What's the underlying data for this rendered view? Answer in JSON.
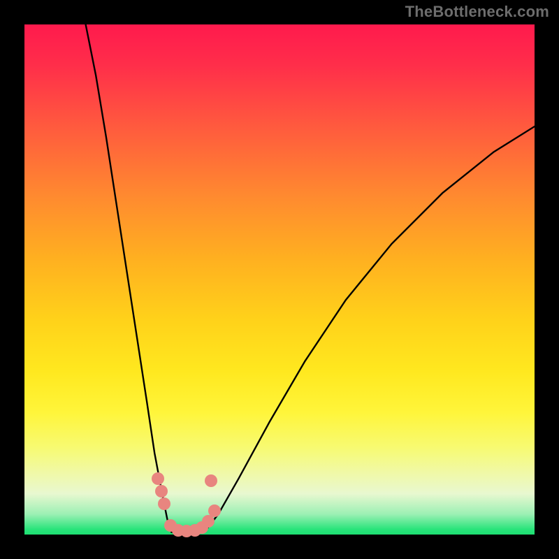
{
  "attribution": "TheBottleneck.com",
  "chart_data": {
    "type": "line",
    "title": "",
    "xlabel": "",
    "ylabel": "",
    "xlim": [
      0,
      100
    ],
    "ylim": [
      0,
      100
    ],
    "gradient_stops": [
      {
        "pct": 0,
        "color": "#ff1a4d"
      },
      {
        "pct": 8,
        "color": "#ff2e4a"
      },
      {
        "pct": 20,
        "color": "#ff5a3e"
      },
      {
        "pct": 34,
        "color": "#ff8b2f"
      },
      {
        "pct": 46,
        "color": "#ffb020"
      },
      {
        "pct": 58,
        "color": "#ffd21a"
      },
      {
        "pct": 68,
        "color": "#ffe81f"
      },
      {
        "pct": 76,
        "color": "#fff53a"
      },
      {
        "pct": 83,
        "color": "#f7fa72"
      },
      {
        "pct": 88,
        "color": "#f0f9a8"
      },
      {
        "pct": 92,
        "color": "#e8f8d0"
      },
      {
        "pct": 96,
        "color": "#9cf0b4"
      },
      {
        "pct": 99,
        "color": "#28e47a"
      },
      {
        "pct": 100,
        "color": "#1ee072"
      }
    ],
    "series": [
      {
        "name": "left-branch",
        "x": [
          12.0,
          14.0,
          16.0,
          18.0,
          20.0,
          22.0,
          24.0,
          25.5,
          27.0,
          28.0,
          28.8
        ],
        "y": [
          100.0,
          90.0,
          78.0,
          65.0,
          52.0,
          39.0,
          26.0,
          16.0,
          8.0,
          3.0,
          0.5
        ]
      },
      {
        "name": "floor",
        "x": [
          28.8,
          30.0,
          32.0,
          34.0,
          35.5
        ],
        "y": [
          0.5,
          0.2,
          0.2,
          0.4,
          0.8
        ]
      },
      {
        "name": "right-branch",
        "x": [
          35.5,
          38.0,
          42.0,
          48.0,
          55.0,
          63.0,
          72.0,
          82.0,
          92.0,
          100.0
        ],
        "y": [
          0.8,
          4.0,
          11.0,
          22.0,
          34.0,
          46.0,
          57.0,
          67.0,
          75.0,
          80.0
        ]
      }
    ],
    "minima_markers": {
      "color": "#e8857f",
      "radius_px": 9,
      "points_xy": [
        [
          26.2,
          11.0
        ],
        [
          26.8,
          8.5
        ],
        [
          27.4,
          6.0
        ],
        [
          28.6,
          1.8
        ],
        [
          30.2,
          0.8
        ],
        [
          31.8,
          0.7
        ],
        [
          33.4,
          0.8
        ],
        [
          34.8,
          1.4
        ],
        [
          36.0,
          2.6
        ],
        [
          37.2,
          4.6
        ],
        [
          36.6,
          10.5
        ]
      ]
    }
  }
}
